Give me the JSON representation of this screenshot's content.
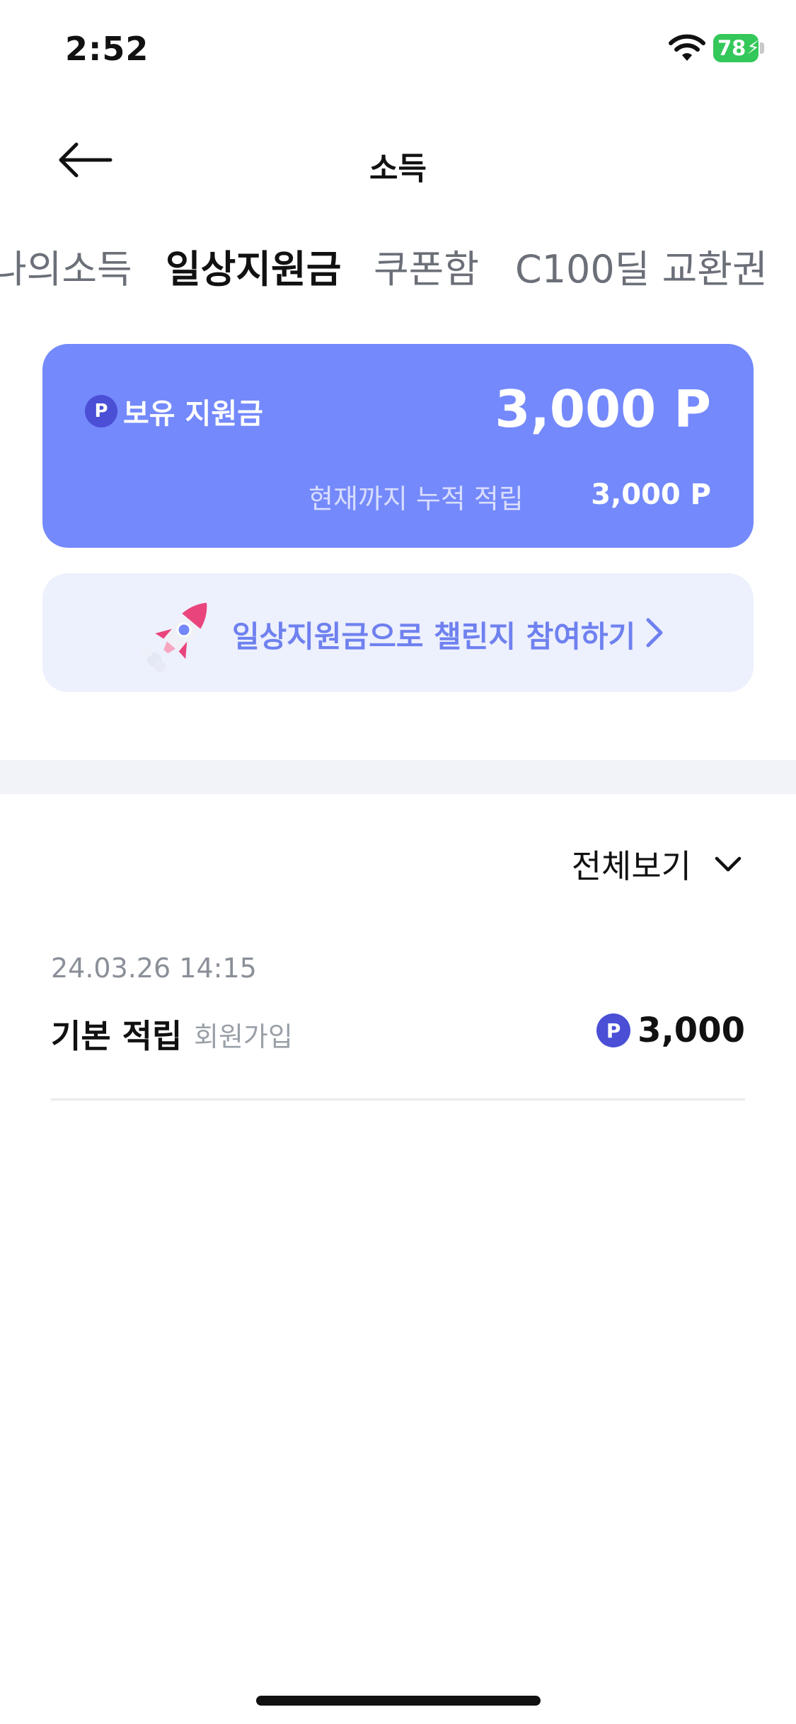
{
  "status_bar": {
    "time": "2:52",
    "battery": "78"
  },
  "header": {
    "title": "소득"
  },
  "tabs": [
    {
      "label": "나의소득",
      "active": false
    },
    {
      "label": "일상지원금",
      "active": true
    },
    {
      "label": "쿠폰함",
      "active": false
    },
    {
      "label": "C100딜 교환권",
      "active": false
    }
  ],
  "balance_card": {
    "badge": "P",
    "label": "보유 지원금",
    "amount": "3,000 P",
    "cumulative_label": "현재까지 누적 적립",
    "cumulative_value": "3,000 P",
    "color": "#7489fb"
  },
  "challenge_banner": {
    "text": "일상지원금으로 챌린지 참여하기",
    "icon": "rocket-icon"
  },
  "filter": {
    "label": "전체보기"
  },
  "history": [
    {
      "date": "24.03.26 14:15",
      "title": "기본 적립",
      "subtitle": "회원가입",
      "badge": "P",
      "amount": "3,000"
    }
  ],
  "colors": {
    "accent": "#7489fb",
    "badge": "#4a4fd6",
    "banner_bg": "#edf0fd",
    "banner_text": "#6f81ef"
  }
}
